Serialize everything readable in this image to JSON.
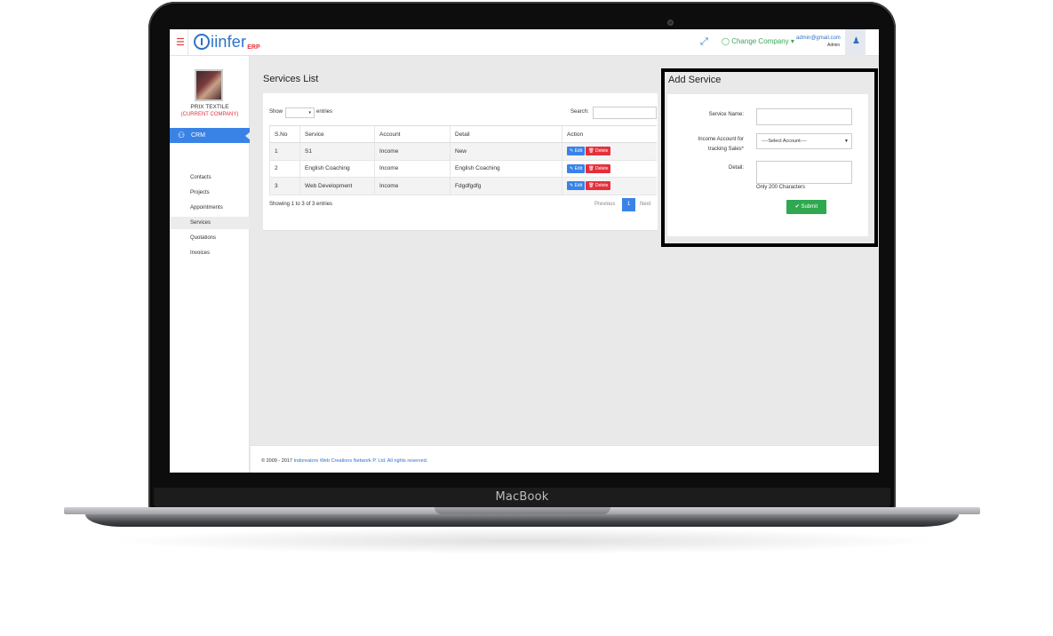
{
  "device": {
    "brand": "MacBook"
  },
  "topbar": {
    "logo_text": "iinfer",
    "logo_sub": "ERP",
    "change_company": "Change Company",
    "user_email": "admin@gmail.com",
    "user_role": "Admin"
  },
  "sidebar": {
    "company_name": "PRIX TEXTILE",
    "company_tag": "(CURRENT COMPANY)",
    "section": "CRM",
    "items": [
      "Contacts",
      "Projects",
      "Appointments",
      "Services",
      "Quotations",
      "Invoices"
    ],
    "active_item": "Services"
  },
  "services_list": {
    "title": "Services List",
    "show_label": "Show",
    "entries_label": "entries",
    "search_label": "Search:",
    "columns": [
      "S.No",
      "Service",
      "Account",
      "Detail",
      "Action"
    ],
    "rows": [
      {
        "sno": "1",
        "service": "S1",
        "account": "Income",
        "detail": "New"
      },
      {
        "sno": "2",
        "service": "English Coaching",
        "account": "Income",
        "detail": "English Coaching"
      },
      {
        "sno": "3",
        "service": "Web Development",
        "account": "Income",
        "detail": "Fdgdfgdfg"
      }
    ],
    "edit_label": "Edit",
    "delete_label": "Delete",
    "showing_text": "Showing 1 to 3 of 3 entries",
    "prev_label": "Previous",
    "current_page": "1",
    "next_label": "Next"
  },
  "add_service": {
    "title": "Add Service",
    "service_name_label": "Service Name:",
    "income_label_1": "Income Account for",
    "income_label_2": "tracking Sales*",
    "select_placeholder": "----Select Account----",
    "detail_label": "Detail:",
    "hint": "Only 200 Characters",
    "submit_label": "Submit"
  },
  "footer": {
    "prefix": "© 2009 - 2017",
    "company": "Indoreators Web Creations Network P. Ltd. All rights reserved."
  },
  "colors": {
    "accent": "#3a83e6",
    "danger": "#e5303c",
    "success": "#2fa84f"
  }
}
